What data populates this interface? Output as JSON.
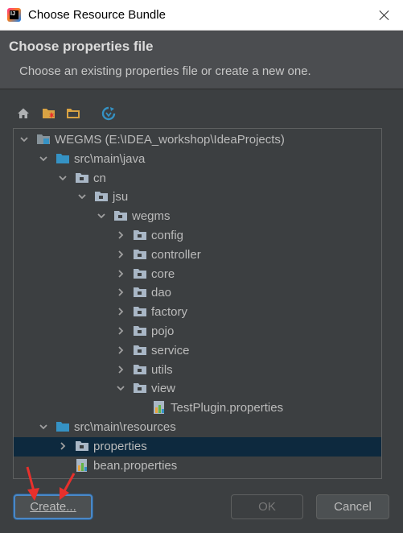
{
  "window": {
    "title": "Choose Resource Bundle"
  },
  "header": {
    "title": "Choose properties file",
    "subtitle": "Choose an existing properties file or create a new one."
  },
  "toolbar": {
    "icons": [
      "home-icon",
      "new-folder-icon",
      "folder-icon",
      "refresh-icon"
    ]
  },
  "tree": {
    "items": [
      {
        "label": "WEGMS (E:\\IDEA_workshop\\IdeaProjects)",
        "depth": 0,
        "expanded": true,
        "type": "module"
      },
      {
        "label": "src\\main\\java",
        "depth": 1,
        "expanded": true,
        "type": "source-root"
      },
      {
        "label": "cn",
        "depth": 2,
        "expanded": true,
        "type": "package"
      },
      {
        "label": "jsu",
        "depth": 3,
        "expanded": true,
        "type": "package"
      },
      {
        "label": "wegms",
        "depth": 4,
        "expanded": true,
        "type": "package"
      },
      {
        "label": "config",
        "depth": 5,
        "expanded": false,
        "type": "package"
      },
      {
        "label": "controller",
        "depth": 5,
        "expanded": false,
        "type": "package"
      },
      {
        "label": "core",
        "depth": 5,
        "expanded": false,
        "type": "package"
      },
      {
        "label": "dao",
        "depth": 5,
        "expanded": false,
        "type": "package"
      },
      {
        "label": "factory",
        "depth": 5,
        "expanded": false,
        "type": "package"
      },
      {
        "label": "pojo",
        "depth": 5,
        "expanded": false,
        "type": "package"
      },
      {
        "label": "service",
        "depth": 5,
        "expanded": false,
        "type": "package"
      },
      {
        "label": "utils",
        "depth": 5,
        "expanded": false,
        "type": "package"
      },
      {
        "label": "view",
        "depth": 5,
        "expanded": true,
        "type": "package"
      },
      {
        "label": "TestPlugin.properties",
        "depth": 6,
        "type": "properties"
      },
      {
        "label": "src\\main\\resources",
        "depth": 1,
        "expanded": true,
        "type": "resource-root"
      },
      {
        "label": "properties",
        "depth": 2,
        "expanded": false,
        "type": "package",
        "selected": true
      },
      {
        "label": "bean.properties",
        "depth": 2,
        "type": "properties"
      }
    ]
  },
  "buttons": {
    "create": "Create...",
    "ok": "OK",
    "cancel": "Cancel"
  },
  "colors": {
    "dialog_bg": "#3c3f41",
    "header_bg": "#4b4d50",
    "selection": "#0d293e",
    "folder_blue": "#3592c4",
    "focus_border": "#4a88c7",
    "annotation_red": "#e8302c"
  }
}
